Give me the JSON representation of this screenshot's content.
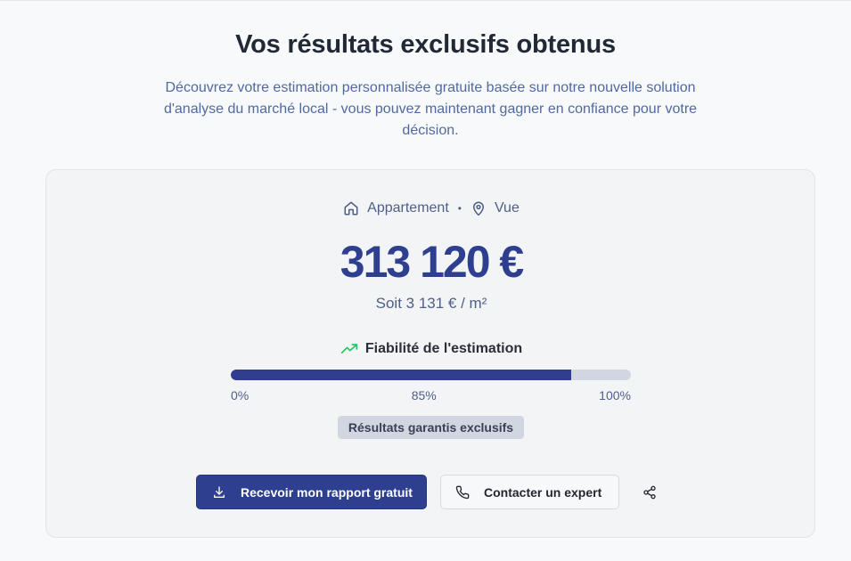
{
  "header": {
    "title": "Vos résultats exclusifs obtenus",
    "subtitle": "Découvrez votre estimation personnalisée gratuite basée sur notre nouvelle solution d'analyse du marché local - vous pouvez maintenant gagner en confiance pour votre décision."
  },
  "estimate": {
    "property_type": "Appartement",
    "separator": "•",
    "location": "Vue",
    "price": "313 120 €",
    "price_per_m2": "Soit 3 131 € / m²"
  },
  "reliability": {
    "label": "Fiabilité de l'estimation",
    "progress": 0.85,
    "min_label": "0%",
    "value_label": "85%",
    "max_label": "100%",
    "badge": "Résultats garantis exclusifs"
  },
  "actions": {
    "download_label": "Recevoir mon rapport gratuit",
    "contact_label": "Contacter un expert"
  },
  "icons": {
    "home": "home-icon",
    "location": "map-pin-icon",
    "trend": "trending-up-icon",
    "download": "download-icon",
    "phone": "phone-icon",
    "share": "share-icon"
  },
  "colors": {
    "accent": "#2f3f8f",
    "trend_green": "#22c55e"
  }
}
